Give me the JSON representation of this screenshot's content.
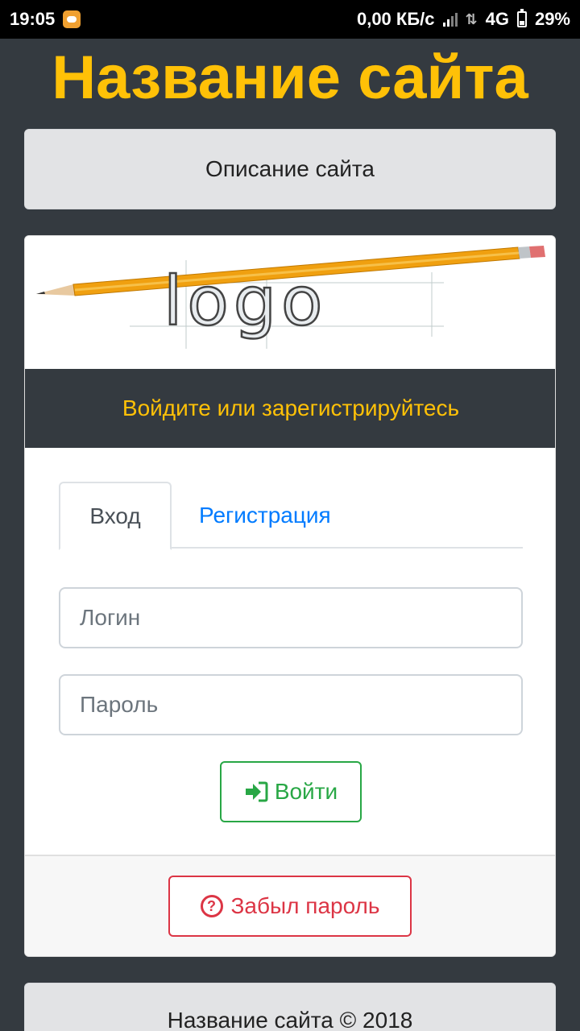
{
  "statusbar": {
    "time": "19:05",
    "network_speed": "0,00 КБ/с",
    "network_type": "4G",
    "battery": "29%"
  },
  "header": {
    "site_title": "Название сайта",
    "site_description": "Описание сайта"
  },
  "card": {
    "logo_text": "logo",
    "header_text": "Войдите или зарегистрируйтесь",
    "tabs": [
      {
        "label": "Вход",
        "active": true
      },
      {
        "label": "Регистрация",
        "active": false
      }
    ],
    "login_field": {
      "placeholder": "Логин",
      "value": ""
    },
    "password_field": {
      "placeholder": "Пароль",
      "value": ""
    },
    "login_button": "Войти",
    "forgot_button": "Забыл пароль"
  },
  "footer": {
    "text": "Название сайта © 2018"
  },
  "colors": {
    "accent": "#ffc107",
    "background": "#343a40",
    "success": "#28a745",
    "danger": "#dc3545",
    "link": "#007bff"
  },
  "icons": {
    "login_button_icon": "sign-in-icon",
    "forgot_button_icon": "question-circle-icon"
  }
}
